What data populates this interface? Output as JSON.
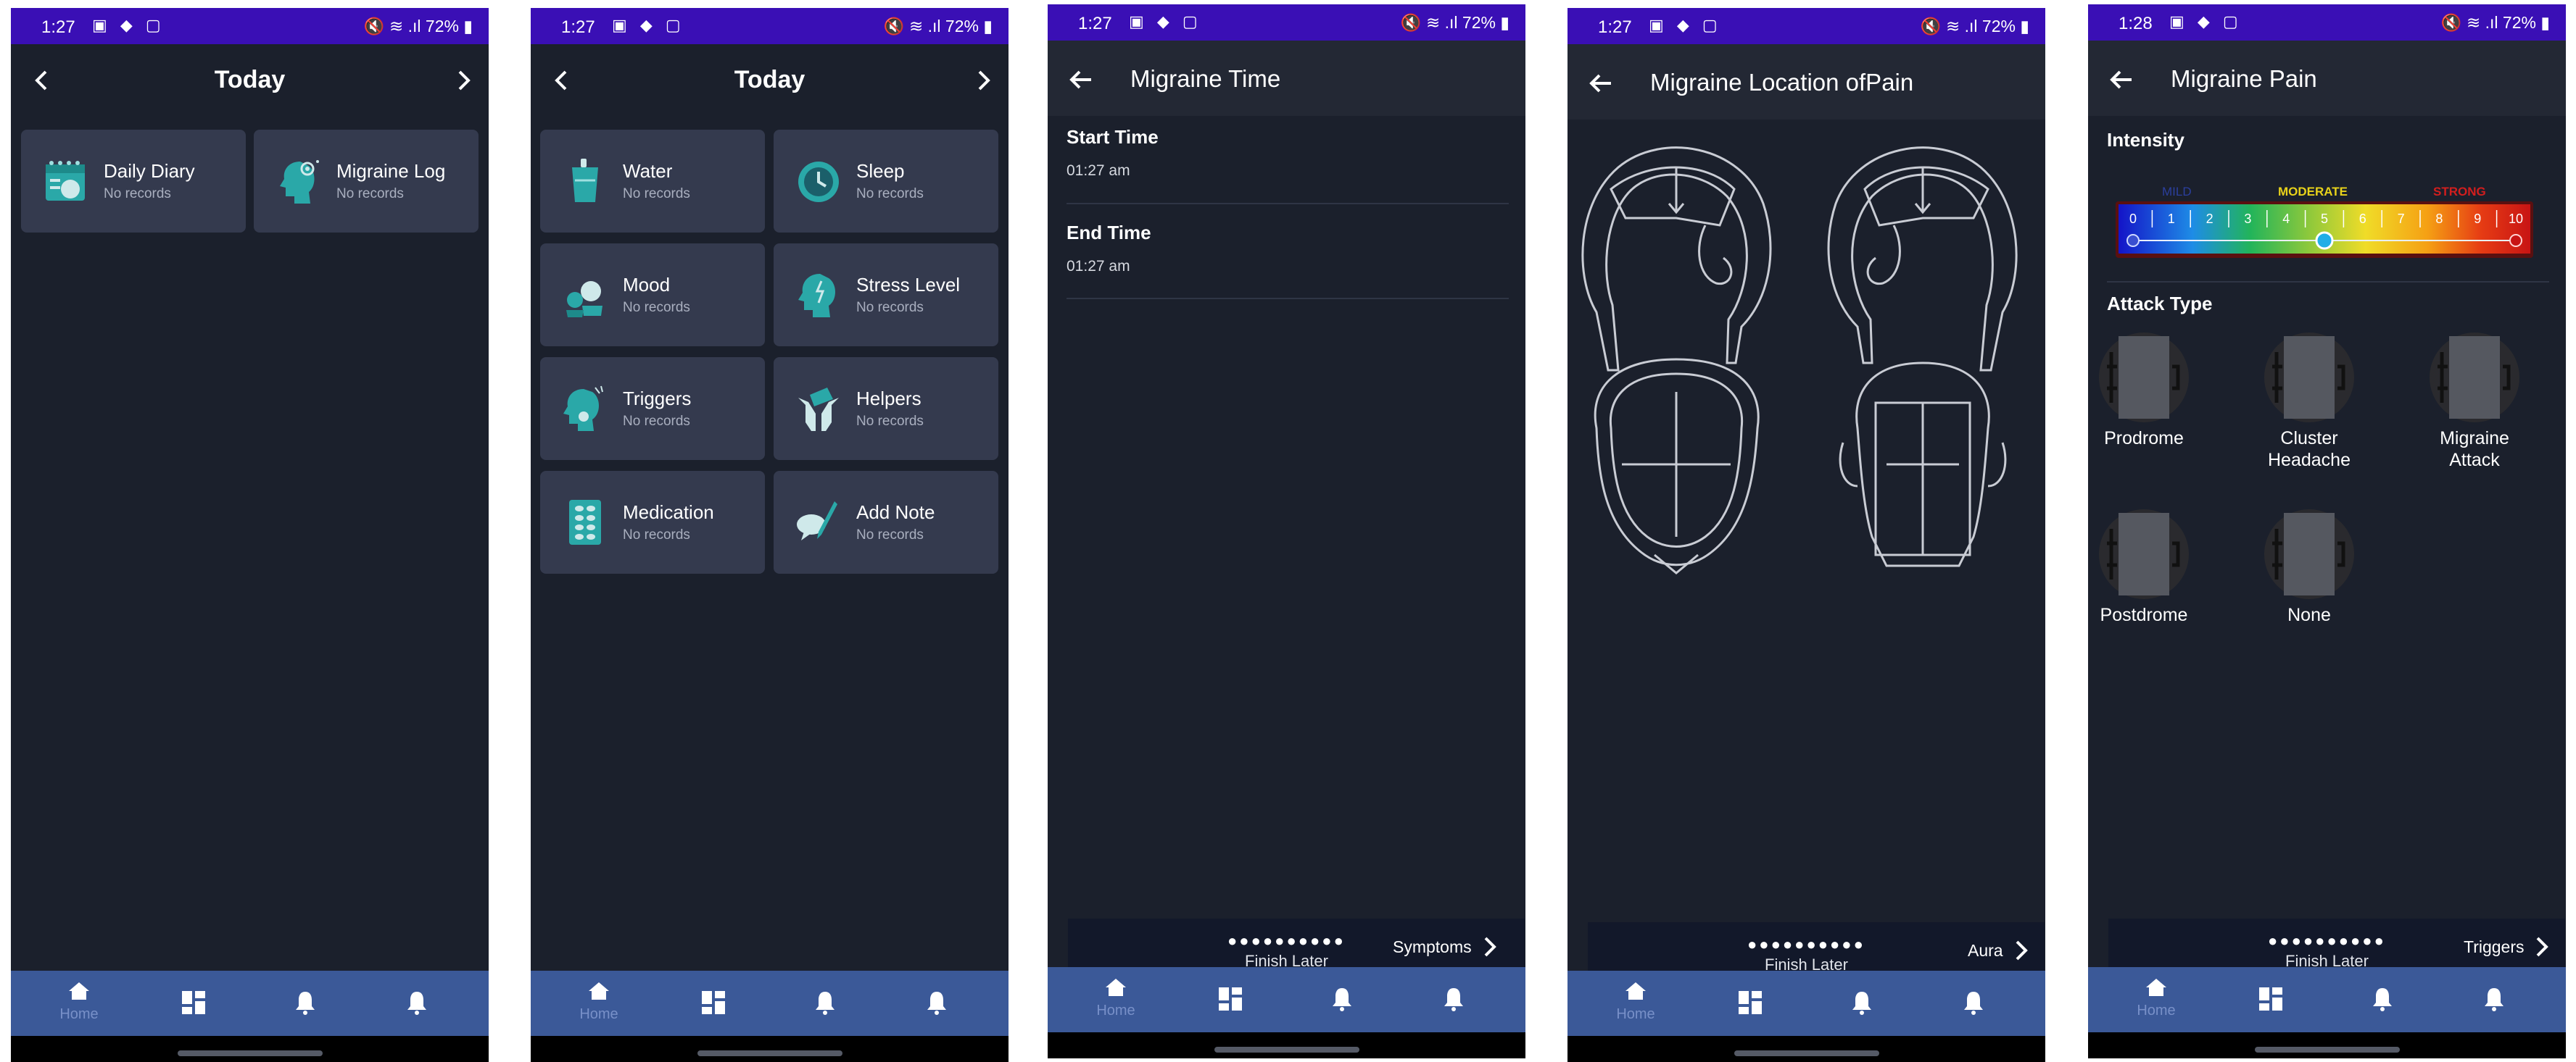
{
  "status": {
    "times": [
      "1:27",
      "1:27",
      "1:27",
      "1:27",
      "1:28"
    ],
    "battery": "72%"
  },
  "nav": {
    "home_label": "Home"
  },
  "screen1": {
    "title": "Today",
    "cards": [
      {
        "title": "Daily Diary",
        "sub": "No records"
      },
      {
        "title": "Migraine Log",
        "sub": "No records"
      }
    ]
  },
  "screen2": {
    "title": "Today",
    "cards": [
      {
        "title": "Water",
        "sub": "No records"
      },
      {
        "title": "Sleep",
        "sub": "No records"
      },
      {
        "title": "Mood",
        "sub": "No records"
      },
      {
        "title": "Stress Level",
        "sub": "No records"
      },
      {
        "title": "Triggers",
        "sub": "No records"
      },
      {
        "title": "Helpers",
        "sub": "No records"
      },
      {
        "title": "Medication",
        "sub": "No records"
      },
      {
        "title": "Add Note",
        "sub": "No records"
      }
    ]
  },
  "screen3": {
    "title": "Migraine Time",
    "start_label": "Start Time",
    "start_value": "01:27 am",
    "end_label": "End Time",
    "end_value": "01:27 am",
    "dots": "●●●●●●●●●●",
    "finish": "Finish Later",
    "next": "Symptoms"
  },
  "screen4": {
    "title": "Migraine Location ofPain",
    "dots": "●●●●●●●●●●",
    "finish": "Finish Later",
    "next": "Aura"
  },
  "screen5": {
    "title": "Migraine Pain",
    "intensity_label": "Intensity",
    "scale": {
      "mild": "MILD",
      "moderate": "MODERATE",
      "strong": "STRONG",
      "numbers": [
        "0",
        "1",
        "2",
        "3",
        "4",
        "5",
        "6",
        "7",
        "8",
        "9",
        "10"
      ],
      "value": 5
    },
    "attack_label": "Attack Type",
    "attacks": [
      "Prodrome",
      "Cluster\nHeadache",
      "Migraine\nAttack",
      "Postdrome",
      "None"
    ],
    "dots": "●●●●●●●●●●",
    "finish": "Finish Later",
    "next": "Triggers"
  },
  "colors": {
    "status_bar": "#3a0fb5",
    "background": "#1b202c",
    "card": "#343a4e",
    "bottom_nav": "#3b5998",
    "teal_icon": "#2aa8a8"
  }
}
